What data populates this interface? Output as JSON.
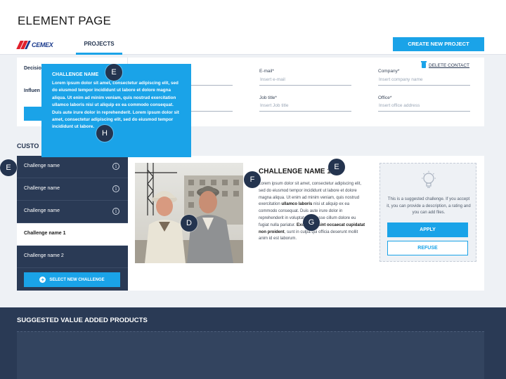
{
  "page_title": "ELEMENT PAGE",
  "header": {
    "logo_text": "CEMEX",
    "tab_projects": "PROJECTS",
    "create_button": "CREATE NEW PROJECT"
  },
  "contact": {
    "left_items": [
      "Decisio",
      "Influen"
    ],
    "delete_label": "DELETE CONTACT",
    "email_label": "E-mail*",
    "email_placeholder": "Insert e-mail",
    "company_label": "Company*",
    "company_placeholder": "Insert company name",
    "jobtitle_label": "Job title*",
    "jobtitle_placeholder": "Insert Job title",
    "office_label": "Office*",
    "office_placeholder": "Insert office address"
  },
  "customer_heading": "CUSTO",
  "challenges": {
    "items": [
      {
        "label": "Challenge name"
      },
      {
        "label": "Challenge name"
      },
      {
        "label": "Challenge name"
      },
      {
        "label": "Challenge name 1"
      },
      {
        "label": "Challenge name 2"
      }
    ],
    "select_button": "SELECT NEW CHALLENGE"
  },
  "detail": {
    "title": "CHALLENGE NAME 1",
    "body_1": "Lorem ipsum dolor sit amet, consectetur adipiscing elit, sed do eiusmod tempor incididunt ut labore et dolore magna aliqua. Ut enim ad minim veniam, quis nostrud exercitation",
    "body_bold_1": "ullamco laboris",
    "body_2": "nisi ut aliquip ex ea commodo consequat. Duis aute irure dolor in reprehenderit in voluptate velit esse cillum dolore eu fugiat nulla pariatur.",
    "body_bold_2": "Excepteur sint occaecat cupidatat non proident",
    "body_3": ", sunt in culpa qui officia deserunt mollit anim id est laborum."
  },
  "suggestion": {
    "text": "This is a suggested challenge. If you accept it, you can provide a description, a rating and you can add files.",
    "apply_button": "APPLY",
    "refuse_button": "REFUSE"
  },
  "products": {
    "title": "SUGGESTED VALUE ADDED PRODUCTS"
  },
  "tooltip": {
    "title": "CHALLENGE NAME",
    "body": "Lorem ipsum dolor sit amet, consectetur adipiscing elit, sed do eiusmod tempor incididunt ut labore et dolore magna aliqua. Ut enim ad minim veniam, quis nostrud exercitation ullamco laboris nisi ut aliquip ex ea commodo consequat. Duis aute irure dolor in reprehenderit. Lorem ipsum dolor sit amet, consectetur adipiscing elit, sed do eiusmod tempor incididunt ut labore."
  },
  "markers": [
    "E",
    "H",
    "E",
    "E",
    "F",
    "D",
    "G"
  ],
  "colors": {
    "accent": "#1aa3e8",
    "navy": "#2a3a55",
    "background": "#eef1f5",
    "logo_red": "#e0202c",
    "logo_blue": "#1a3a8c"
  },
  "icons": [
    "trash-icon",
    "info-icon",
    "plus-icon",
    "lightbulb-icon"
  ]
}
